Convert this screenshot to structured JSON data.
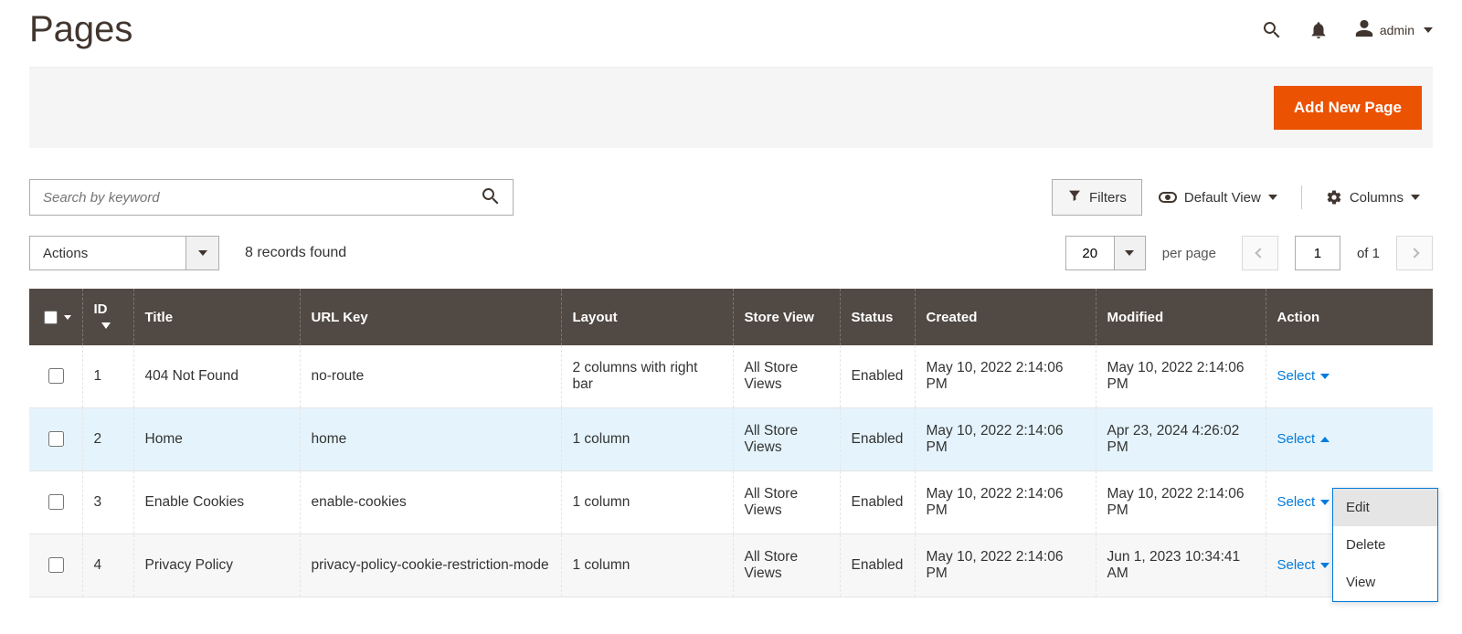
{
  "header": {
    "title": "Pages",
    "user": "admin"
  },
  "primary_button": "Add New Page",
  "search": {
    "placeholder": "Search by keyword"
  },
  "controls": {
    "filters": "Filters",
    "default_view": "Default View",
    "columns": "Columns"
  },
  "toolbar": {
    "actions_label": "Actions",
    "records_text": "8 records found",
    "per_page_value": "20",
    "per_page_label": "per page",
    "page_current": "1",
    "page_of_label": "of 1"
  },
  "columns": {
    "id": "ID",
    "title": "Title",
    "url": "URL Key",
    "layout": "Layout",
    "store": "Store View",
    "status": "Status",
    "created": "Created",
    "modified": "Modified",
    "action": "Action"
  },
  "action_label": "Select",
  "rows": [
    {
      "id": "1",
      "title": "404 Not Found",
      "url": "no-route",
      "layout": "2 columns with right bar",
      "store": "All Store Views",
      "status": "Enabled",
      "created": "May 10, 2022 2:14:06 PM",
      "modified": "May 10, 2022 2:14:06 PM"
    },
    {
      "id": "2",
      "title": "Home",
      "url": "home",
      "layout": "1 column",
      "store": "All Store Views",
      "status": "Enabled",
      "created": "May 10, 2022 2:14:06 PM",
      "modified": "Apr 23, 2024 4:26:02 PM"
    },
    {
      "id": "3",
      "title": "Enable Cookies",
      "url": "enable-cookies",
      "layout": "1 column",
      "store": "All Store Views",
      "status": "Enabled",
      "created": "May 10, 2022 2:14:06 PM",
      "modified": "May 10, 2022 2:14:06 PM"
    },
    {
      "id": "4",
      "title": "Privacy Policy",
      "url": "privacy-policy-cookie-restriction-mode",
      "layout": "1 column",
      "store": "All Store Views",
      "status": "Enabled",
      "created": "May 10, 2022 2:14:06 PM",
      "modified": "Jun 1, 2023 10:34:41 AM"
    }
  ],
  "menu": {
    "edit": "Edit",
    "delete": "Delete",
    "view": "View"
  }
}
